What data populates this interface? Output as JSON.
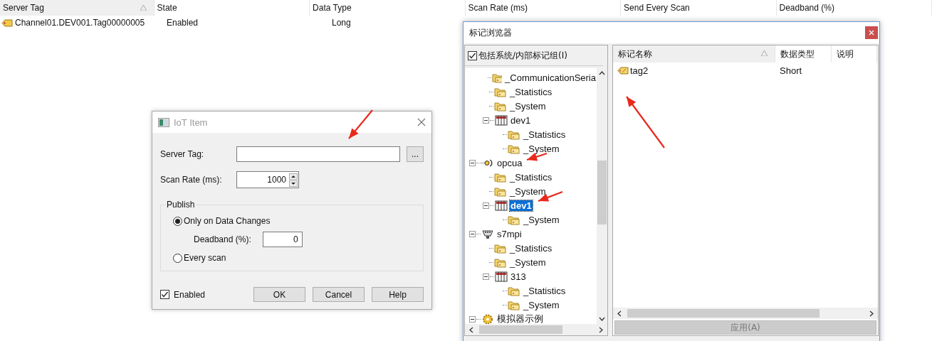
{
  "table": {
    "columns": [
      {
        "label": "Server Tag",
        "sorted": true
      },
      {
        "label": "State",
        "sorted": false
      },
      {
        "label": "Data Type",
        "sorted": false
      },
      {
        "label": "Scan Rate (ms)",
        "sorted": false
      },
      {
        "label": "Send Every Scan",
        "sorted": false
      },
      {
        "label": "Deadband (%)",
        "sorted": false
      }
    ],
    "rows": [
      {
        "cells": [
          "Channel01.DEV001.Tag00000005",
          "Enabled",
          "Long"
        ]
      }
    ]
  },
  "iot_dialog": {
    "title": "IoT Item",
    "server_tag": {
      "label": "Server Tag:"
    },
    "browse_button": "...",
    "scan_rate": {
      "label": "Scan Rate (ms):",
      "value": "1000"
    },
    "publish": {
      "title": "Publish",
      "options": [
        {
          "label": "Only on Data Changes",
          "selected": true
        },
        {
          "label": "Every scan",
          "selected": false
        }
      ],
      "deadband": {
        "label": "Deadband (%):",
        "value": "0"
      }
    },
    "enabled": {
      "label": "Enabled",
      "checked": true
    },
    "buttons": [
      "OK",
      "Cancel",
      "Help"
    ]
  },
  "tag_browser": {
    "title": "标记浏览器",
    "include_system": {
      "label": "包括系统/内部标记组(I)",
      "checked": true
    },
    "tree": {
      "continued": [
        {
          "label": "_CommunicationSeria",
          "kind": "folder",
          "selected": false
        },
        {
          "label": "_Statistics",
          "kind": "folder",
          "selected": false
        },
        {
          "label": "_System",
          "kind": "folder",
          "selected": false
        },
        {
          "label": "dev1",
          "kind": "device",
          "selected": false,
          "expanded": true,
          "children": [
            {
              "label": "_Statistics",
              "kind": "folder",
              "selected": false
            },
            {
              "label": "_System",
              "kind": "folder",
              "selected": false
            }
          ]
        }
      ],
      "nodes": [
        {
          "label": "opcua",
          "kind": "opc-channel",
          "selected": false,
          "expanded": true,
          "children": [
            {
              "label": "_Statistics",
              "kind": "folder",
              "selected": false
            },
            {
              "label": "_System",
              "kind": "folder",
              "selected": false
            },
            {
              "label": "dev1",
              "kind": "device",
              "selected": true,
              "expanded": true,
              "children": [
                {
                  "label": "_System",
                  "kind": "folder",
                  "selected": false
                }
              ]
            }
          ]
        },
        {
          "label": "s7mpi",
          "kind": "serial-channel",
          "selected": false,
          "expanded": true,
          "children": [
            {
              "label": "_Statistics",
              "kind": "folder",
              "selected": false
            },
            {
              "label": "_System",
              "kind": "folder",
              "selected": false
            },
            {
              "label": "313",
              "kind": "device",
              "selected": false,
              "expanded": true,
              "children": [
                {
                  "label": "_Statistics",
                  "kind": "folder",
                  "selected": false
                },
                {
                  "label": "_System",
                  "kind": "folder",
                  "selected": false
                }
              ]
            }
          ]
        },
        {
          "label": "模拟器示例",
          "kind": "simulator",
          "selected": false,
          "expanded": true
        }
      ]
    },
    "tag_list": {
      "columns": [
        {
          "label": "标记名称",
          "sorted": true
        },
        {
          "label": "数据类型",
          "sorted": false
        },
        {
          "label": "说明",
          "sorted": false
        }
      ],
      "rows": [
        {
          "cells": [
            "tag2",
            "Short"
          ]
        }
      ]
    },
    "apply_button": {
      "label": "应用(A)",
      "disabled": true
    }
  }
}
